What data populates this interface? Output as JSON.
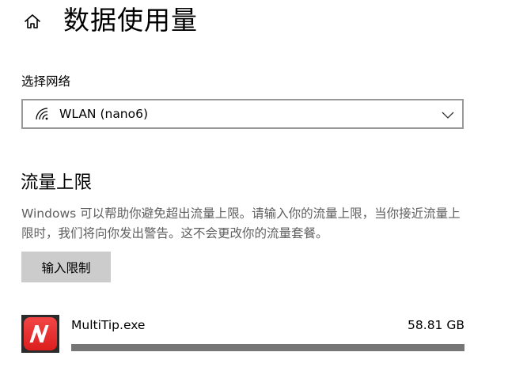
{
  "header": {
    "title": "数据使用量",
    "home_icon": "home-icon"
  },
  "network": {
    "label": "选择网络",
    "selected": "WLAN (nano6)",
    "icon": "wifi-icon"
  },
  "data_limit": {
    "heading": "流量上限",
    "description": "Windows 可以帮助你避免超出流量上限。请输入你的流量上限，当你接近流量上限时，我们将向你发出警告。这不会更改你的流量套餐。",
    "button_label": "输入限制"
  },
  "apps": [
    {
      "name": "MultiTip.exe",
      "usage": "58.81 GB",
      "usage_fraction": 1.0,
      "icon": "multitip-app-icon",
      "icon_color": "#e83232"
    }
  ],
  "colors": {
    "bar_fill": "#767676",
    "button_bg": "#cccccc",
    "select_border": "#999999",
    "description_text": "#5f5f5f"
  }
}
